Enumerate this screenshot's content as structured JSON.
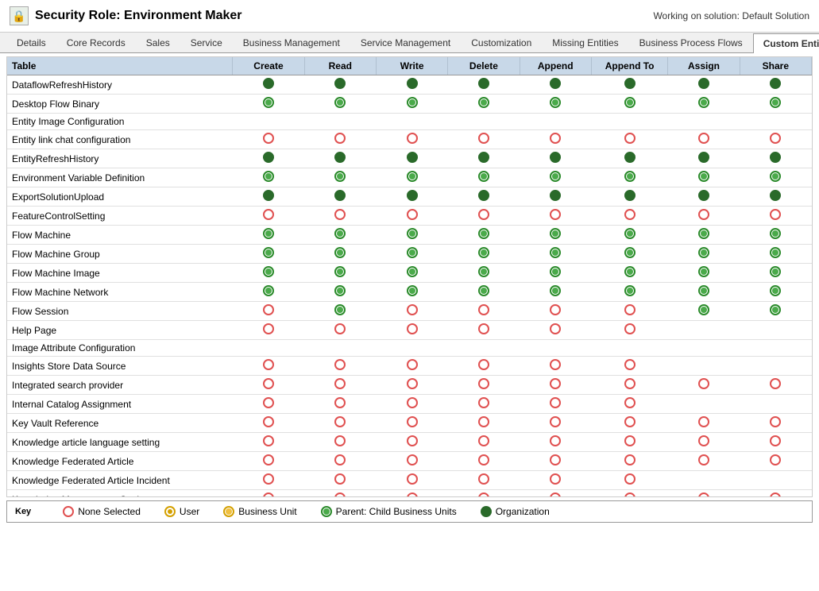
{
  "header": {
    "title": "Security Role: Environment Maker",
    "working_on": "Working on solution: Default Solution",
    "icon": "🔒"
  },
  "tabs": [
    {
      "label": "Details",
      "active": false
    },
    {
      "label": "Core Records",
      "active": false
    },
    {
      "label": "Sales",
      "active": false
    },
    {
      "label": "Service",
      "active": false
    },
    {
      "label": "Business Management",
      "active": false
    },
    {
      "label": "Service Management",
      "active": false
    },
    {
      "label": "Customization",
      "active": false
    },
    {
      "label": "Missing Entities",
      "active": false
    },
    {
      "label": "Business Process Flows",
      "active": false
    },
    {
      "label": "Custom Entities",
      "active": true
    }
  ],
  "table": {
    "columns": [
      "Table",
      "Create",
      "Read",
      "Write",
      "Delete",
      "Append",
      "Append To",
      "Assign",
      "Share"
    ],
    "rows": [
      {
        "name": "DataflowRefreshHistory",
        "create": "org",
        "read": "org",
        "write": "org",
        "delete": "org",
        "append": "org",
        "appendTo": "org",
        "assign": "org",
        "share": "org"
      },
      {
        "name": "Desktop Flow Binary",
        "create": "pbu",
        "read": "pbu",
        "write": "pbu",
        "delete": "pbu",
        "append": "pbu",
        "appendTo": "pbu",
        "assign": "pbu",
        "share": "pbu"
      },
      {
        "name": "Entity Image Configuration",
        "create": "",
        "read": "",
        "write": "",
        "delete": "",
        "append": "",
        "appendTo": "",
        "assign": "",
        "share": ""
      },
      {
        "name": "Entity link chat configuration",
        "create": "none",
        "read": "none",
        "write": "none",
        "delete": "none",
        "append": "none",
        "appendTo": "none",
        "assign": "none",
        "share": "none"
      },
      {
        "name": "EntityRefreshHistory",
        "create": "org",
        "read": "org",
        "write": "org",
        "delete": "org",
        "append": "org",
        "appendTo": "org",
        "assign": "org",
        "share": "org"
      },
      {
        "name": "Environment Variable Definition",
        "create": "pbu",
        "read": "pbu",
        "write": "pbu",
        "delete": "pbu",
        "append": "pbu",
        "appendTo": "pbu",
        "assign": "pbu",
        "share": "pbu"
      },
      {
        "name": "ExportSolutionUpload",
        "create": "org",
        "read": "org",
        "write": "org",
        "delete": "org",
        "append": "org",
        "appendTo": "org",
        "assign": "org",
        "share": "org"
      },
      {
        "name": "FeatureControlSetting",
        "create": "none",
        "read": "none",
        "write": "none",
        "delete": "none",
        "append": "none",
        "appendTo": "none",
        "assign": "none",
        "share": "none"
      },
      {
        "name": "Flow Machine",
        "create": "pbu",
        "read": "pbu",
        "write": "pbu",
        "delete": "pbu",
        "append": "pbu",
        "appendTo": "pbu",
        "assign": "pbu",
        "share": "pbu"
      },
      {
        "name": "Flow Machine Group",
        "create": "pbu",
        "read": "pbu",
        "write": "pbu",
        "delete": "pbu",
        "append": "pbu",
        "appendTo": "pbu",
        "assign": "pbu",
        "share": "pbu"
      },
      {
        "name": "Flow Machine Image",
        "create": "pbu",
        "read": "pbu",
        "write": "pbu",
        "delete": "pbu",
        "append": "pbu",
        "appendTo": "pbu",
        "assign": "pbu",
        "share": "pbu"
      },
      {
        "name": "Flow Machine Network",
        "create": "pbu",
        "read": "pbu",
        "write": "pbu",
        "delete": "pbu",
        "append": "pbu",
        "appendTo": "pbu",
        "assign": "pbu",
        "share": "pbu"
      },
      {
        "name": "Flow Session",
        "create": "none",
        "read": "pbu",
        "write": "none",
        "delete": "none",
        "append": "none",
        "appendTo": "none",
        "assign": "pbu",
        "share": "pbu"
      },
      {
        "name": "Help Page",
        "create": "none",
        "read": "none",
        "write": "none",
        "delete": "none",
        "append": "none",
        "appendTo": "none",
        "assign": "",
        "share": ""
      },
      {
        "name": "Image Attribute Configuration",
        "create": "",
        "read": "",
        "write": "",
        "delete": "",
        "append": "",
        "appendTo": "",
        "assign": "",
        "share": ""
      },
      {
        "name": "Insights Store Data Source",
        "create": "none",
        "read": "none",
        "write": "none",
        "delete": "none",
        "append": "none",
        "appendTo": "none",
        "assign": "",
        "share": ""
      },
      {
        "name": "Integrated search provider",
        "create": "none",
        "read": "none",
        "write": "none",
        "delete": "none",
        "append": "none",
        "appendTo": "none",
        "assign": "none",
        "share": "none"
      },
      {
        "name": "Internal Catalog Assignment",
        "create": "none",
        "read": "none",
        "write": "none",
        "delete": "none",
        "append": "none",
        "appendTo": "none",
        "assign": "",
        "share": ""
      },
      {
        "name": "Key Vault Reference",
        "create": "none",
        "read": "none",
        "write": "none",
        "delete": "none",
        "append": "none",
        "appendTo": "none",
        "assign": "none",
        "share": "none"
      },
      {
        "name": "Knowledge article language setting",
        "create": "none",
        "read": "none",
        "write": "none",
        "delete": "none",
        "append": "none",
        "appendTo": "none",
        "assign": "none",
        "share": "none"
      },
      {
        "name": "Knowledge Federated Article",
        "create": "none",
        "read": "none",
        "write": "none",
        "delete": "none",
        "append": "none",
        "appendTo": "none",
        "assign": "none",
        "share": "none"
      },
      {
        "name": "Knowledge Federated Article Incident",
        "create": "none",
        "read": "none",
        "write": "none",
        "delete": "none",
        "append": "none",
        "appendTo": "none",
        "assign": "",
        "share": ""
      },
      {
        "name": "Knowledge Management Setting",
        "create": "none",
        "read": "none",
        "write": "none",
        "delete": "none",
        "append": "none",
        "appendTo": "none",
        "assign": "none",
        "share": "none"
      }
    ]
  },
  "key": {
    "title": "Key",
    "items": [
      {
        "label": "None Selected",
        "type": "none"
      },
      {
        "label": "User",
        "type": "user"
      },
      {
        "label": "Business Unit",
        "type": "bu"
      },
      {
        "label": "Parent: Child Business Units",
        "type": "pbu"
      },
      {
        "label": "Organization",
        "type": "org"
      }
    ]
  }
}
